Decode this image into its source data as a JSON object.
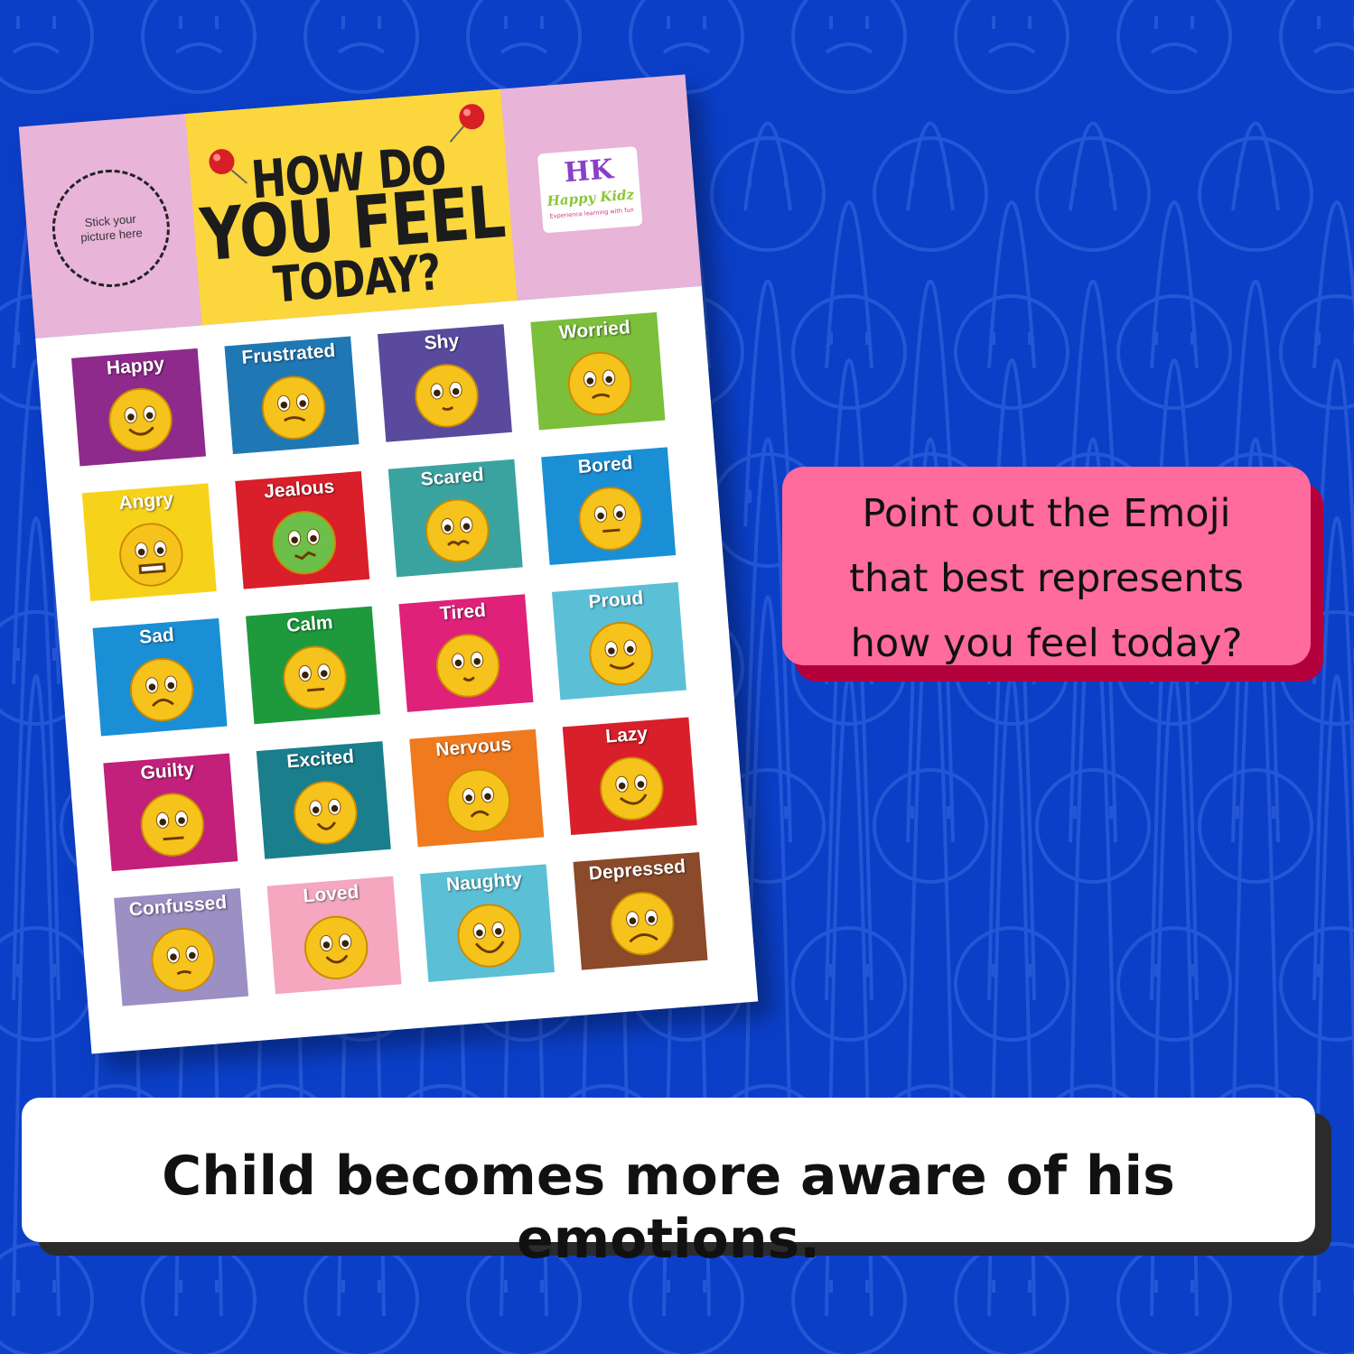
{
  "poster": {
    "sticker_text": "Stick your picture here",
    "title_line1": "HOW DO",
    "title_line2": "YOU FEEL",
    "title_line3": "TODAY?",
    "logo_mark": "HK",
    "logo_name": "Happy Kidz",
    "logo_tagline": "Experience learning with fun",
    "emotions": [
      {
        "label": "Happy",
        "color": "#8e2a8c",
        "face": "happy"
      },
      {
        "label": "Frustrated",
        "color": "#1f78b4",
        "face": "frustrated"
      },
      {
        "label": "Shy",
        "color": "#5a4a9e",
        "face": "shy"
      },
      {
        "label": "Worried",
        "color": "#7bbf3a",
        "face": "worried"
      },
      {
        "label": "Angry",
        "color": "#f7d21a",
        "face": "angry"
      },
      {
        "label": "Jealous",
        "color": "#d91f2a",
        "face": "jealous"
      },
      {
        "label": "Scared",
        "color": "#3aa3a0",
        "face": "scared"
      },
      {
        "label": "Bored",
        "color": "#1a8fd6",
        "face": "bored"
      },
      {
        "label": "Sad",
        "color": "#1a8fd6",
        "face": "sad"
      },
      {
        "label": "Calm",
        "color": "#1e9a3c",
        "face": "calm"
      },
      {
        "label": "Tired",
        "color": "#e0217a",
        "face": "tired"
      },
      {
        "label": "Proud",
        "color": "#5bc0d6",
        "face": "proud"
      },
      {
        "label": "Guilty",
        "color": "#c2207a",
        "face": "guilty"
      },
      {
        "label": "Excited",
        "color": "#1a7e8c",
        "face": "excited"
      },
      {
        "label": "Nervous",
        "color": "#f07a1e",
        "face": "nervous"
      },
      {
        "label": "Lazy",
        "color": "#d91f2a",
        "face": "lazy"
      },
      {
        "label": "Confussed",
        "color": "#9b8fc4",
        "face": "confused"
      },
      {
        "label": "Loved",
        "color": "#f4a7bf",
        "face": "loved"
      },
      {
        "label": "Naughty",
        "color": "#5bc0d6",
        "face": "naughty"
      },
      {
        "label": "Depressed",
        "color": "#8b4a2a",
        "face": "depressed"
      }
    ]
  },
  "callout_pink": {
    "line1": "Point out the Emoji",
    "line2": "that best represents",
    "line3": "how you feel today?"
  },
  "callout_white": {
    "text": "Child becomes more aware of his emotions."
  },
  "colors": {
    "background": "#0b3fc8",
    "header_pink": "#e8b4d8",
    "title_yellow": "#fbd63d",
    "callout_pink": "#ff6b9d"
  }
}
